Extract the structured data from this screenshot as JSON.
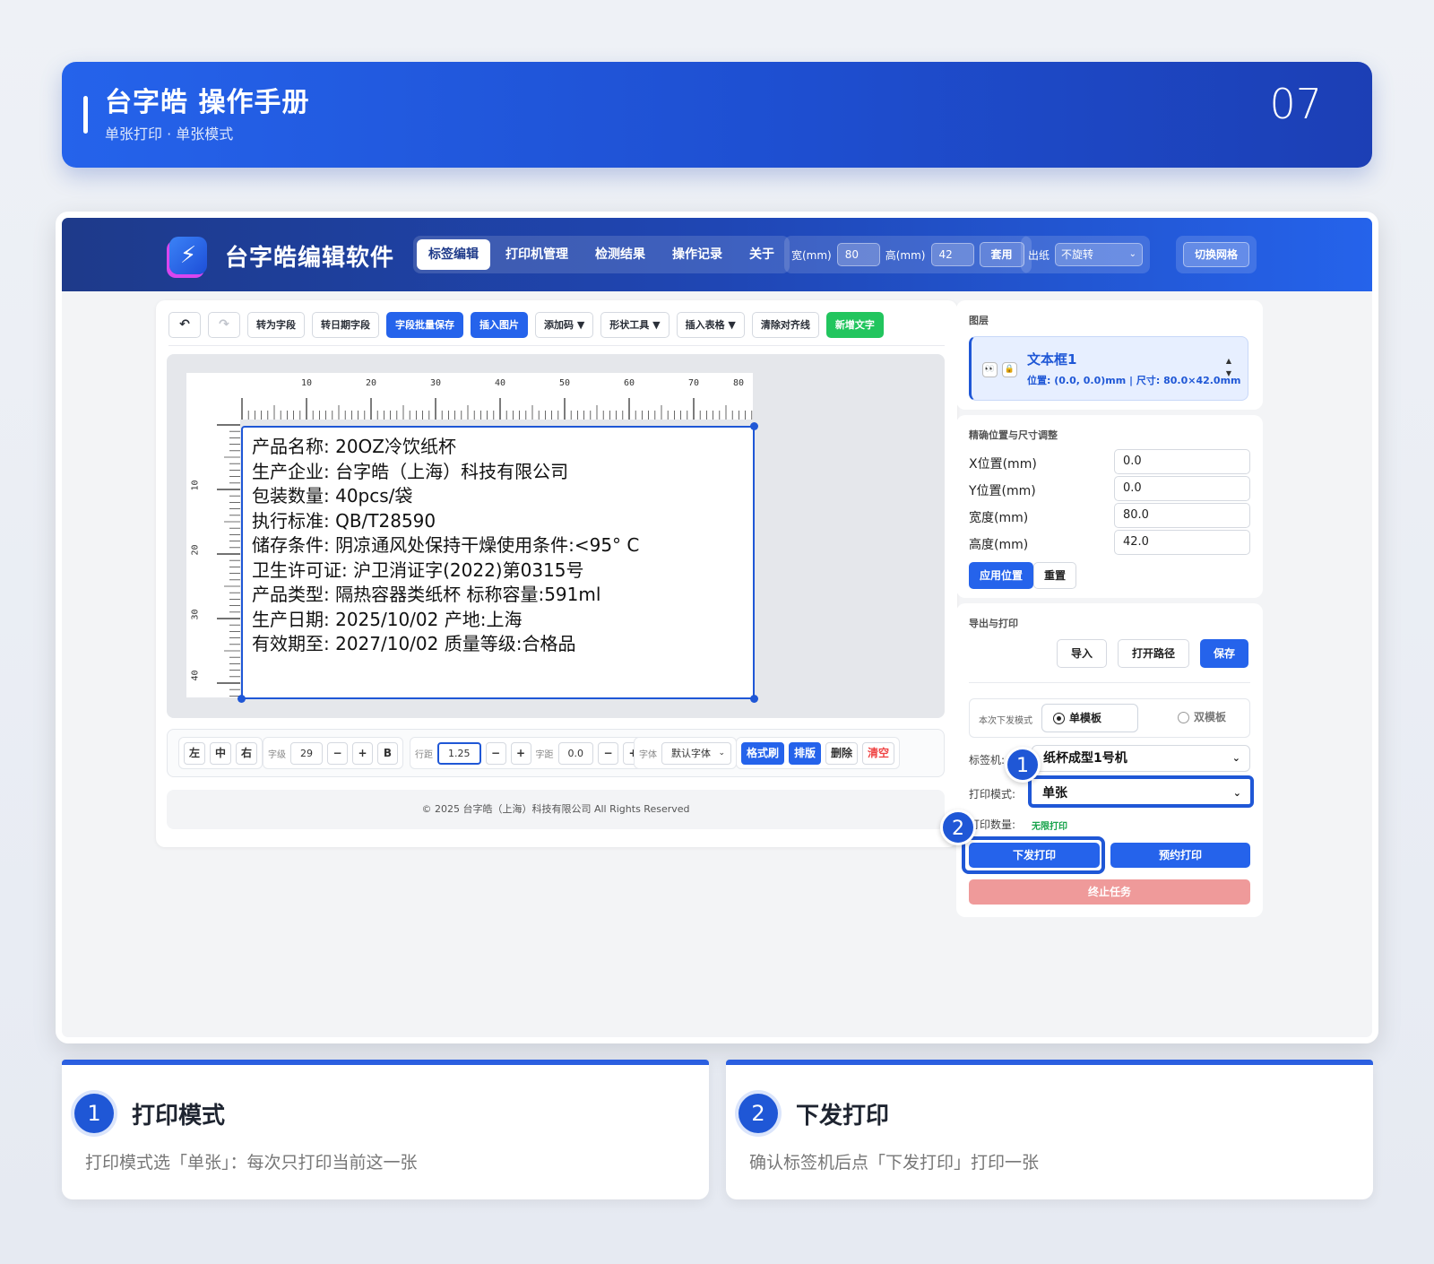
{
  "header": {
    "title": "台字皓 操作手册",
    "subtitle": "单张打印 · 单张模式",
    "page_number": "07"
  },
  "app": {
    "name": "台字皓编辑软件",
    "logo_icon": "lightning-icon",
    "nav_tabs": [
      "标签编辑",
      "打印机管理",
      "检测结果",
      "操作记录",
      "关于"
    ],
    "active_tab": "标签编辑",
    "width_label": "宽(mm)",
    "width_value": "80",
    "height_label": "高(mm)",
    "height_value": "42",
    "apply_size": "套用",
    "paper_label": "出纸",
    "rotation_value": "不旋转",
    "toggle_grid": "切换网格"
  },
  "toolbar": {
    "undo_icon": "undo-icon",
    "redo_icon": "redo-icon",
    "to_field": "转为字段",
    "to_date_field": "转日期字段",
    "batch_save": "字段批量保存",
    "insert_image": "插入图片",
    "add_code": "添加码 ▼",
    "shape_tools": "形状工具 ▼",
    "insert_table": "插入表格 ▼",
    "clear_guides": "清除对齐线",
    "new_text": "新增文字"
  },
  "ruler": {
    "top": [
      "10",
      "20",
      "30",
      "40",
      "50",
      "60",
      "70",
      "80"
    ],
    "left": [
      "10",
      "20",
      "30",
      "40"
    ]
  },
  "label_lines": [
    "产品名称:   20OZ冷饮纸杯",
    "生产企业:   台字皓（上海）科技有限公司",
    "包装数量:   40pcs/袋",
    "执行标准:   QB/T28590",
    "储存条件:   阴凉通风处保持干燥使用条件:<95° C",
    "卫生许可证:   沪卫消证字(2022)第0315号",
    "产品类型:   隔热容器类纸杯 标称容量:591ml",
    "生产日期:   2025/10/02 产地:上海",
    "有效期至:   2027/10/02 质量等级:合格品"
  ],
  "format_bar": {
    "align_left": "左",
    "align_center": "中",
    "align_right": "右",
    "font_size_label": "字级",
    "font_size": "29",
    "minus": "−",
    "plus": "+",
    "bold": "B",
    "line_height_label": "行距",
    "line_height": "1.25",
    "letter_spacing_label": "字距",
    "letter_spacing": "0.0",
    "font_label": "字体",
    "font_value": "默认字体",
    "format_painter": "格式刷",
    "layout": "排版",
    "delete": "删除",
    "clear": "清空"
  },
  "footer": "© 2025 台字皓（上海）科技有限公司 All Rights Reserved",
  "layers": {
    "title": "图层",
    "item_name": "文本框1",
    "item_info": "位置: (0.0, 0.0)mm | 尺寸: 80.0×42.0mm"
  },
  "position": {
    "title": "精确位置与尺寸调整",
    "x_label": "X位置(mm)",
    "x": "0.0",
    "y_label": "Y位置(mm)",
    "y": "0.0",
    "w_label": "宽度(mm)",
    "w": "80.0",
    "h_label": "高度(mm)",
    "h": "42.0",
    "apply": "应用位置",
    "reset": "重置"
  },
  "export": {
    "title": "导出与打印",
    "import": "导入",
    "open_path": "打开路径",
    "save": "保存",
    "mode_label": "本次下发模式",
    "single_template": "单模板",
    "double_template": "双模板",
    "printer_label": "标签机:",
    "printer_value": "纸杯成型1号机",
    "print_mode_label": "打印模式:",
    "print_mode_value": "单张",
    "print_count_label": "打印数量:",
    "print_count_value": "无限打印",
    "send_print": "下发打印",
    "schedule_print": "预约打印",
    "stop_task": "终止任务"
  },
  "callouts": [
    "1",
    "2"
  ],
  "steps": [
    {
      "num": "1",
      "title": "打印模式",
      "desc": "打印模式选「单张」：每次只打印当前这一张"
    },
    {
      "num": "2",
      "title": "下发打印",
      "desc": "确认标签机后点「下发打印」打印一张"
    }
  ],
  "colors": {
    "brand": "#2563eb",
    "accent_dark": "#1e3a8a",
    "success": "#22c55e",
    "danger": "#ef4444",
    "stop_btn": "#ef9a9a"
  }
}
